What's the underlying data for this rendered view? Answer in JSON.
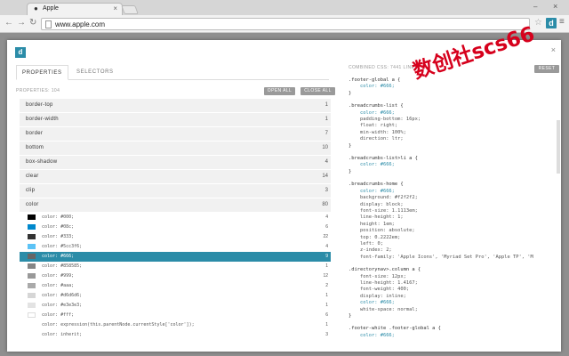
{
  "browser": {
    "tab_title": "Apple",
    "tab_icon": "apple-icon",
    "tab_close": "×",
    "url": "www.apple.com",
    "back": "←",
    "forward": "→",
    "reload": "↻",
    "star": "☆",
    "ext_icon_letter": "d",
    "menu": "≡",
    "win_min": "–",
    "win_close": "×"
  },
  "panel": {
    "logo_letter": "d",
    "close": "×",
    "tabs": [
      "PROPERTIES",
      "SELECTORS"
    ],
    "property_count": "PROPERTIES: 104",
    "open_all": "OPEN ALL",
    "close_all": "CLOSE ALL",
    "accent_color": "#2b8ca8",
    "properties": [
      {
        "name": "border-top",
        "count": "1"
      },
      {
        "name": "border-width",
        "count": "1"
      },
      {
        "name": "border",
        "count": "7"
      },
      {
        "name": "bottom",
        "count": "10"
      },
      {
        "name": "box-shadow",
        "count": "4"
      },
      {
        "name": "clear",
        "count": "14"
      },
      {
        "name": "clip",
        "count": "3"
      },
      {
        "name": "color",
        "count": "80"
      }
    ],
    "color_values": [
      {
        "text": "color: #000;",
        "count": "4",
        "swatch": "#000000"
      },
      {
        "text": "color: #08c;",
        "count": "6",
        "swatch": "#0088cc"
      },
      {
        "text": "color: #333;",
        "count": "22",
        "swatch": "#333333"
      },
      {
        "text": "color: #5cc3f6;",
        "count": "4",
        "swatch": "#5cc3f6"
      },
      {
        "text": "color: #666;",
        "count": "9",
        "swatch": "#666666"
      },
      {
        "text": "color: #858585;",
        "count": "1",
        "swatch": "#858585"
      },
      {
        "text": "color: #999;",
        "count": "12",
        "swatch": "#999999"
      },
      {
        "text": "color: #aaa;",
        "count": "2",
        "swatch": "#aaaaaa"
      },
      {
        "text": "color: #d6d6d6;",
        "count": "1",
        "swatch": "#d6d6d6"
      },
      {
        "text": "color: #e3e3e3;",
        "count": "1",
        "swatch": "#e3e3e3"
      },
      {
        "text": "color: #fff;",
        "count": "6",
        "swatch": "#ffffff"
      },
      {
        "text": "color: expression(this.parentNode.currentStyle['color']);",
        "count": "1",
        "swatch": ""
      },
      {
        "text": "color: inherit;",
        "count": "3",
        "swatch": ""
      }
    ],
    "selected_value_index": 4,
    "right_title": "COMBINED CSS: 7441 LINES",
    "reset": "RESET",
    "code_blocks": [
      [
        ".footer-global a {",
        "    color: #666;",
        "}"
      ],
      [
        ".breadcrumbs-list {",
        "    color: #666;",
        "    padding-bottom: 16px;",
        "    float: right;",
        "    min-width: 100%;",
        "    direction: ltr;",
        "}"
      ],
      [
        ".breadcrumbs-list>li a {",
        "    color: #666;",
        "}"
      ],
      [
        ".breadcrumbs-home {",
        "    color: #666;",
        "    background: #f2f2f2;",
        "    display: block;",
        "    font-size: 1.1113em;",
        "    line-height: 1;",
        "    height: 1em;",
        "    position: absolute;",
        "    top: 0.2222em;",
        "    left: 0;",
        "    z-index: 2;",
        "    font-family: 'Apple Icons', 'Myriad Set Pro', 'Apple TP', 'M"
      ],
      [
        ".directorynav>.column a {",
        "    font-size: 12px;",
        "    line-height: 1.4167;",
        "    font-weight: 400;",
        "    display: inline;",
        "    color: #666;",
        "    white-space: normal;",
        "}"
      ],
      [
        ".footer-white .footer-global a {",
        "    color: #666;"
      ]
    ],
    "watermark": "数创社scs66"
  }
}
